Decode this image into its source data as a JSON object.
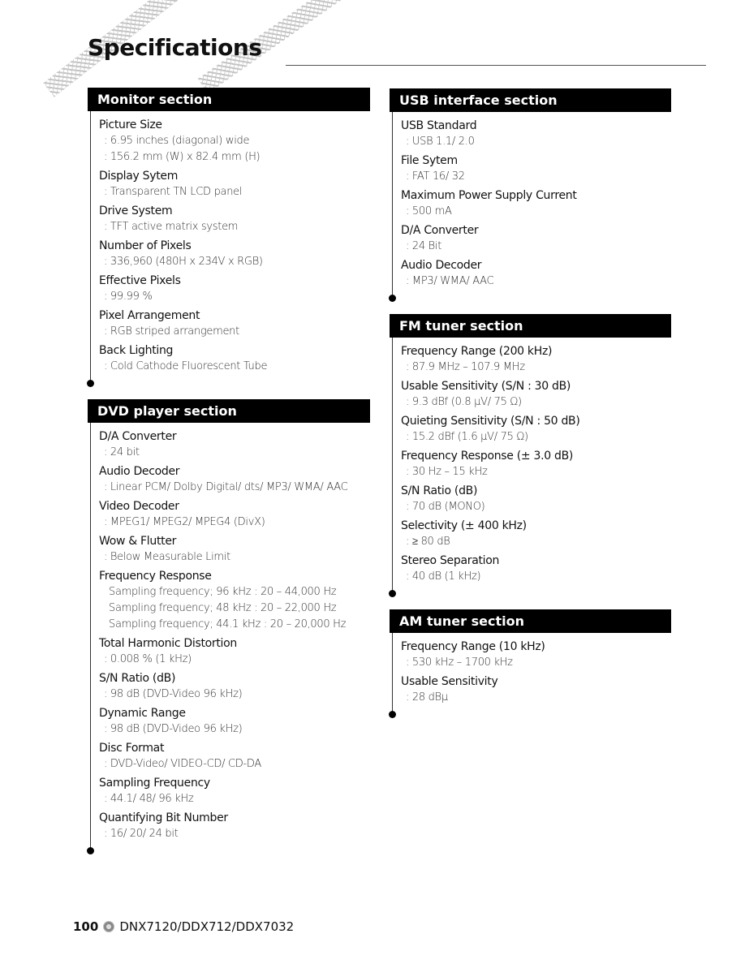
{
  "page": {
    "title": "Specifications",
    "footer": {
      "page_number": "100",
      "model_text": "DNX7120/DDX712/DDX7032"
    }
  },
  "sections": {
    "monitor": {
      "title": "Monitor section",
      "items": [
        {
          "label": "Picture Size",
          "values": [
            ": 6.95 inches (diagonal) wide",
            ": 156.2 mm (W) x 82.4 mm (H)"
          ]
        },
        {
          "label": "Display Sytem",
          "values": [
            ": Transparent TN LCD panel"
          ]
        },
        {
          "label": "Drive System",
          "values": [
            ": TFT active matrix system"
          ]
        },
        {
          "label": "Number of Pixels",
          "values": [
            ": 336,960 (480H x 234V x RGB)"
          ]
        },
        {
          "label": "Effective Pixels",
          "values": [
            ": 99.99 %"
          ]
        },
        {
          "label": "Pixel Arrangement",
          "values": [
            ": RGB striped arrangement"
          ]
        },
        {
          "label": "Back Lighting",
          "values": [
            ": Cold Cathode Fluorescent Tube"
          ]
        }
      ]
    },
    "dvd": {
      "title": "DVD player section",
      "items": [
        {
          "label": "D/A Converter",
          "values": [
            ": 24 bit"
          ]
        },
        {
          "label": "Audio Decoder",
          "values": [
            ": Linear PCM/ Dolby Digital/ dts/ MP3/ WMA/ AAC"
          ]
        },
        {
          "label": "Video Decoder",
          "values": [
            ": MPEG1/ MPEG2/ MPEG4 (DivX)"
          ]
        },
        {
          "label": "Wow & Flutter",
          "values": [
            ": Below Measurable Limit"
          ]
        },
        {
          "label": "Frequency Response",
          "values": [
            "Sampling frequency; 96 kHz : 20 – 44,000 Hz",
            "Sampling frequency; 48 kHz : 20 – 22,000 Hz",
            "Sampling frequency; 44.1 kHz : 20 – 20,000 Hz"
          ],
          "indent": true
        },
        {
          "label": "Total Harmonic Distortion",
          "values": [
            ": 0.008 % (1 kHz)"
          ]
        },
        {
          "label": "S/N Ratio (dB)",
          "values": [
            ": 98 dB (DVD-Video 96 kHz)"
          ]
        },
        {
          "label": "Dynamic Range",
          "values": [
            ": 98 dB (DVD-Video 96 kHz)"
          ]
        },
        {
          "label": "Disc Format",
          "values": [
            ": DVD-Video/ VIDEO-CD/ CD-DA"
          ]
        },
        {
          "label": "Sampling Frequency",
          "values": [
            ": 44.1/ 48/ 96 kHz"
          ]
        },
        {
          "label": "Quantifying Bit Number",
          "values": [
            ": 16/ 20/ 24 bit"
          ]
        }
      ]
    },
    "usb": {
      "title": "USB interface section",
      "items": [
        {
          "label": "USB Standard",
          "values": [
            ": USB 1.1/ 2.0"
          ]
        },
        {
          "label": "File Sytem",
          "values": [
            ": FAT 16/ 32"
          ]
        },
        {
          "label": "Maximum Power Supply Current",
          "values": [
            ": 500 mA"
          ]
        },
        {
          "label": "D/A Converter",
          "values": [
            ": 24 Bit"
          ]
        },
        {
          "label": "Audio Decoder",
          "values": [
            ": MP3/ WMA/ AAC"
          ]
        }
      ]
    },
    "fm": {
      "title": "FM tuner section",
      "items": [
        {
          "label": "Frequency Range (200 kHz)",
          "values": [
            ": 87.9 MHz – 107.9 MHz"
          ]
        },
        {
          "label": "Usable Sensitivity (S/N : 30 dB)",
          "values": [
            ": 9.3 dBf (0.8 μV/ 75 Ω)"
          ]
        },
        {
          "label": "Quieting Sensitivity (S/N : 50 dB)",
          "values": [
            ": 15.2 dBf (1.6 μV/ 75 Ω)"
          ]
        },
        {
          "label": "Frequency Response (± 3.0 dB)",
          "values": [
            ": 30 Hz – 15 kHz"
          ]
        },
        {
          "label": "S/N Ratio (dB)",
          "values": [
            ": 70 dB (MONO)"
          ]
        },
        {
          "label": "Selectivity (± 400 kHz)",
          "values": [
            ": ≥ 80 dB"
          ]
        },
        {
          "label": "Stereo Separation",
          "values": [
            ": 40 dB (1 kHz)"
          ]
        }
      ]
    },
    "am": {
      "title": "AM tuner section",
      "items": [
        {
          "label": "Frequency Range (10 kHz)",
          "values": [
            ": 530 kHz – 1700 kHz"
          ]
        },
        {
          "label": "Usable Sensitivity",
          "values": [
            ": 28 dBμ"
          ]
        }
      ]
    }
  }
}
